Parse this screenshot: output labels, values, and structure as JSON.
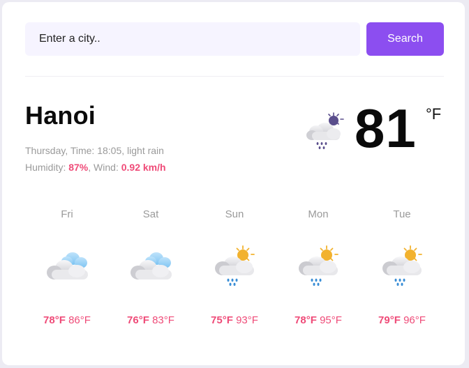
{
  "search": {
    "placeholder": "Enter a city..",
    "button_label": "Search"
  },
  "current": {
    "city": "Hanoi",
    "day_time_label": "Thursday, Time: 18:05, light rain",
    "humidity_label": "Humidity: ",
    "humidity_value": "87%",
    "wind_label": ", Wind: ",
    "wind_value": "0.92 km/h",
    "temperature": "81",
    "unit": "°F",
    "icon": "night-cloud-rain-icon"
  },
  "forecast": [
    {
      "day": "Fri",
      "low": "78°F",
      "high": "86°F",
      "icon": "cloudy-icon"
    },
    {
      "day": "Sat",
      "low": "76°F",
      "high": "83°F",
      "icon": "cloudy-icon"
    },
    {
      "day": "Sun",
      "low": "75°F",
      "high": "93°F",
      "icon": "sun-cloud-rain-icon"
    },
    {
      "day": "Mon",
      "low": "78°F",
      "high": "95°F",
      "icon": "sun-cloud-rain-icon"
    },
    {
      "day": "Tue",
      "low": "79°F",
      "high": "96°F",
      "icon": "sun-cloud-rain-icon"
    }
  ],
  "colors": {
    "accent": "#8c4ef0",
    "highlight": "#ef4b78",
    "muted": "#9a9a9a",
    "input_bg": "#f6f4ff"
  }
}
